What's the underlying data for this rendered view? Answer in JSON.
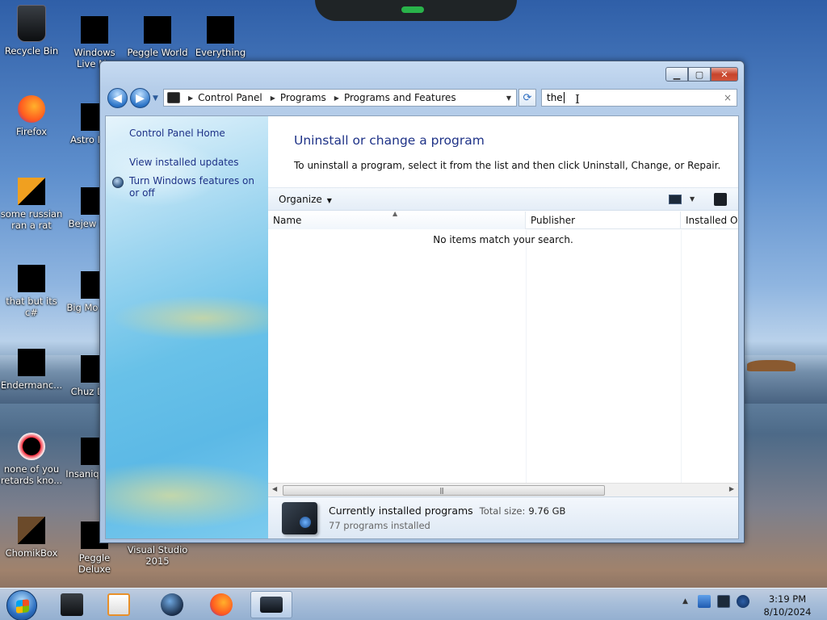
{
  "desktop": {
    "icons": [
      {
        "label": "Recycle Bin"
      },
      {
        "label": "Windows Live Ma"
      },
      {
        "label": "Peggle World"
      },
      {
        "label": "Everything"
      },
      {
        "label": "Firefox"
      },
      {
        "label": "Astro Delu"
      },
      {
        "label": "some russian ran a rat"
      },
      {
        "label": "Bejew Delu"
      },
      {
        "label": "that but its c#"
      },
      {
        "label": "Big Mo Delu"
      },
      {
        "label": "Endermanc..."
      },
      {
        "label": "Chuz Delu"
      },
      {
        "label": "none of you retards kno..."
      },
      {
        "label": "Insaniq Delu"
      },
      {
        "label": "ChomikBox"
      },
      {
        "label": "Peggle Deluxe"
      },
      {
        "label": "Visual Studio 2015"
      }
    ]
  },
  "window": {
    "caption_buttons": {
      "minimize": "▁",
      "maximize": "▢",
      "close": "✕"
    },
    "nav": {
      "back": "◀",
      "forward": "▶",
      "recent": "▼"
    },
    "address": {
      "crumbs": [
        "Control Panel",
        "Programs",
        "Programs and Features"
      ],
      "refresh": "⟳"
    },
    "search": {
      "value": "the",
      "clear": "×"
    },
    "left_pane": {
      "home": "Control Panel Home",
      "updates": "View installed updates",
      "features": "Turn Windows features on or off"
    },
    "main": {
      "title": "Uninstall or change a program",
      "description": "To uninstall a program, select it from the list and then click Uninstall, Change, or Repair.",
      "toolbar": {
        "organize": "Organize"
      },
      "columns": {
        "name": "Name",
        "publisher": "Publisher",
        "installed_on": "Installed On"
      },
      "empty_message": "No items match your search.",
      "details": {
        "title": "Currently installed programs",
        "total_size_label": "Total size:",
        "total_size_value": "9.76 GB",
        "count": "77 programs installed"
      }
    }
  },
  "taskbar": {
    "clock": {
      "time": "3:19 PM",
      "date": "8/10/2024"
    },
    "items": [
      "media-center-icon",
      "media-player-icon",
      "orb-app-icon",
      "firefox-icon",
      "programs-window-icon"
    ]
  }
}
